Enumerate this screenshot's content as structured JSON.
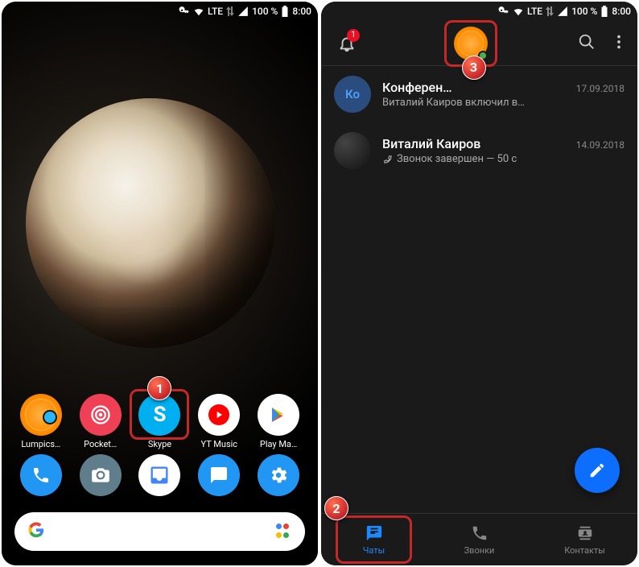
{
  "status": {
    "network": "LTE",
    "battery": "100 %",
    "time": "8:00"
  },
  "home": {
    "apps": [
      {
        "label": "Lumpics…"
      },
      {
        "label": "Pocket…"
      },
      {
        "label": "Skype"
      },
      {
        "label": "YT Music"
      },
      {
        "label": "Play Ma…"
      }
    ]
  },
  "skype": {
    "notif_count": "1",
    "chats": [
      {
        "name": "Конферен…",
        "date": "17.09.2018",
        "sub": "Виталий Каиров включил в…",
        "avatar_bg": "#2b4c7e",
        "avatar_text": "Ко",
        "avatar_color": "#4da6ff"
      },
      {
        "name": "Виталий Каиров",
        "date": "14.09.2018",
        "sub": "Звонок завершен — 50 с",
        "avatar_bg": "#222",
        "avatar_text": "",
        "avatar_color": "#fff"
      }
    ],
    "nav": {
      "chats": "Чаты",
      "calls": "Звонки",
      "contacts": "Контакты"
    }
  },
  "steps": {
    "s1": "1",
    "s2": "2",
    "s3": "3"
  }
}
